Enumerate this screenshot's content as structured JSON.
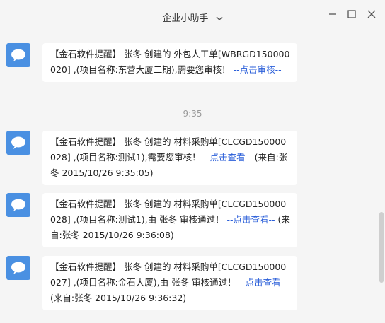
{
  "window": {
    "title": "企业小助手",
    "icons": {
      "dropdown": "chevron-down-icon",
      "minimize": "minimize-icon",
      "maximize": "maximize-icon",
      "close": "close-icon"
    }
  },
  "chat": {
    "timestamp": "9:35",
    "messages": [
      {
        "avatar": "chat-bubble-icon",
        "text": "【金石软件提醒】 张冬 创建的 外包人工单[WBRGD150000020] ,(项目名称:东营大厦二期),需要您审核！",
        "link": "--点击审核--",
        "tail": ""
      },
      {
        "avatar": "chat-bubble-icon",
        "text": "【金石软件提醒】 张冬 创建的 材料采购单[CLCGD150000028] ,(项目名称:测试1),需要您审核！",
        "link": "--点击查看--",
        "tail": "(来自:张冬 2015/10/26 9:35:05)"
      },
      {
        "avatar": "chat-bubble-icon",
        "text": "【金石软件提醒】 张冬 创建的 材料采购单[CLCGD150000028] ,(项目名称:测试1),由 张冬 审核通过！",
        "link": "--点击查看--",
        "tail": "(来自:张冬 2015/10/26 9:36:08)"
      },
      {
        "avatar": "chat-bubble-icon",
        "text": "【金石软件提醒】 张冬 创建的 材料采购单[CLCGD150000027] ,(项目名称:金石大厦),由 张冬 审核通过！",
        "link": "--点击查看--",
        "tail": "(来自:张冬 2015/10/26 9:36:32)"
      }
    ]
  },
  "colors": {
    "background": "#f5f5f5",
    "avatar": "#4a90e2",
    "link": "#2b5fd9",
    "bubble": "#ffffff"
  }
}
